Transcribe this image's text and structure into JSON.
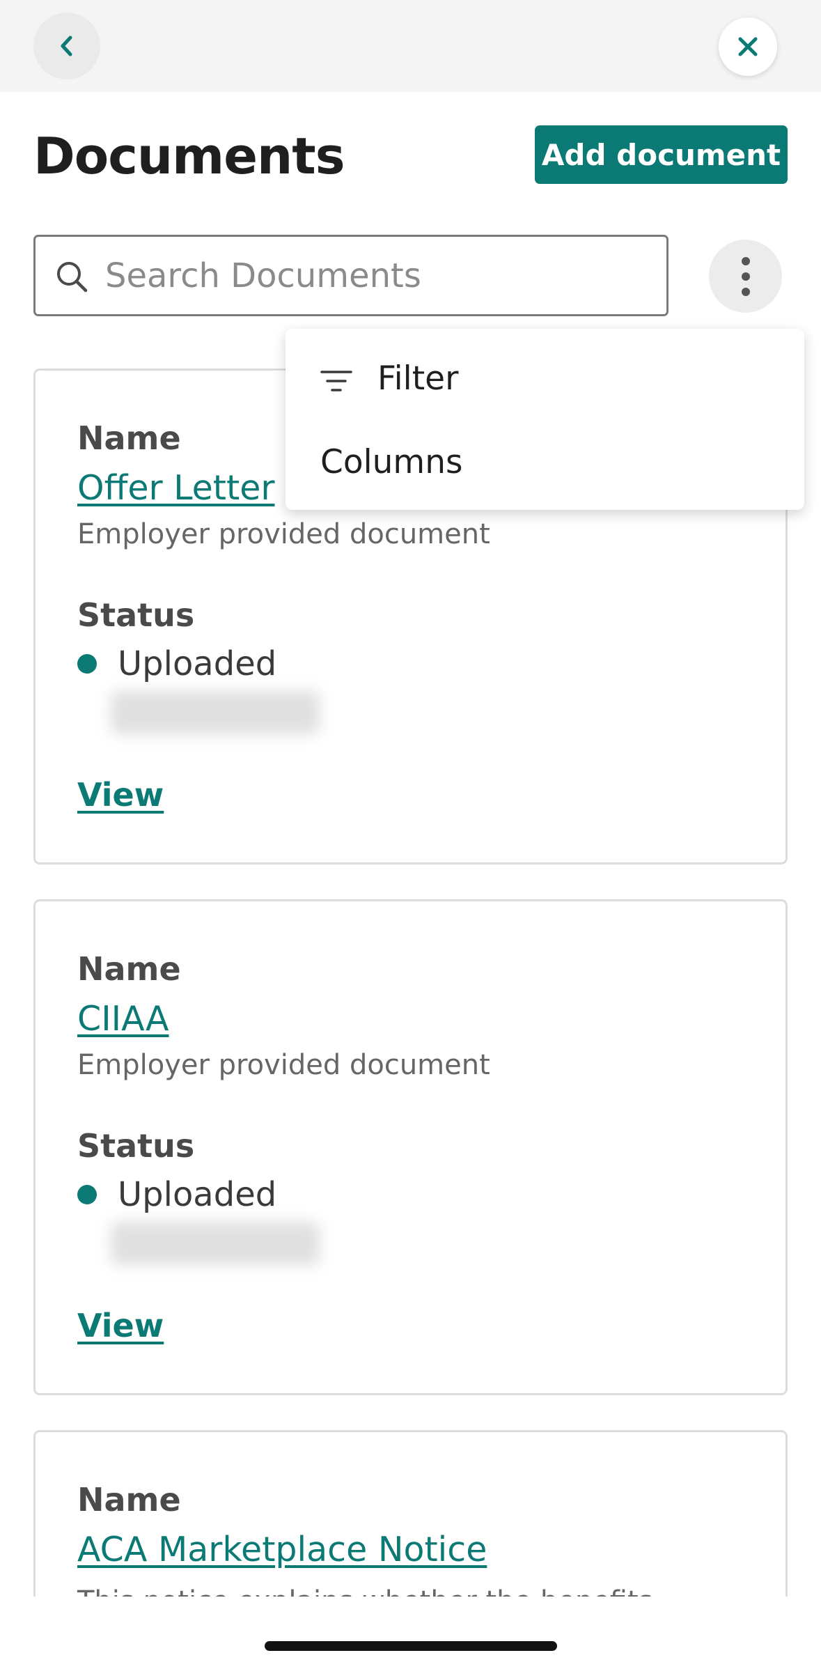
{
  "header": {
    "back_icon": "chevron-left-icon",
    "close_icon": "close-icon",
    "title": "Documents",
    "add_label": "Add document"
  },
  "search": {
    "placeholder": "Search Documents",
    "icon": "search-icon"
  },
  "more_menu": {
    "icon": "vertical-dots-icon",
    "items": [
      {
        "label": "Filter",
        "icon": "filter-icon"
      },
      {
        "label": "Columns"
      }
    ]
  },
  "documents": [
    {
      "name_label": "Name",
      "name": "Offer Letter",
      "description": "Employer provided document",
      "status_label": "Status",
      "status": "Uploaded",
      "view_label": "View"
    },
    {
      "name_label": "Name",
      "name": "CIIAA",
      "description": "Employer provided document",
      "status_label": "Status",
      "status": "Uploaded",
      "view_label": "View"
    },
    {
      "name_label": "Name",
      "name": "ACA Marketplace Notice",
      "description": "This notice explains whether the benefits"
    }
  ],
  "colors": {
    "accent": "#0b7a75",
    "topbar_bg": "#f4f4f4",
    "card_border": "#dcdcdc"
  }
}
